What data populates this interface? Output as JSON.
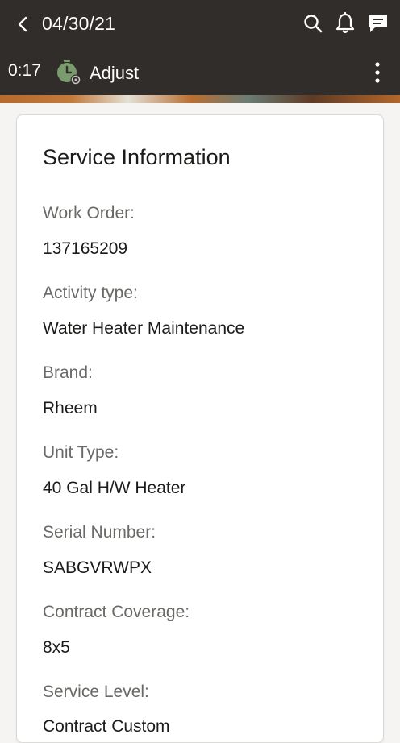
{
  "header": {
    "date": "04/30/21",
    "timer": "0:17",
    "adjust_label": "Adjust",
    "icons": {
      "back": "chevron-left-icon",
      "search": "search-icon",
      "notifications": "bell-icon",
      "messages": "chat-icon",
      "timer": "stopwatch-icon",
      "more": "more-vertical-icon"
    },
    "colors": {
      "bar": "#312d2a",
      "timer_icon": "#7a9b6e"
    }
  },
  "card": {
    "title": "Service Information",
    "fields": [
      {
        "label": "Work Order:",
        "value": "137165209"
      },
      {
        "label": "Activity type:",
        "value": "Water Heater Maintenance"
      },
      {
        "label": "Brand:",
        "value": "Rheem"
      },
      {
        "label": "Unit Type:",
        "value": "40 Gal H/W Heater"
      },
      {
        "label": "Serial Number:",
        "value": "SABGVRWPX"
      },
      {
        "label": "Contract Coverage:",
        "value": "8x5"
      },
      {
        "label": "Service Level:",
        "value": "Contract Custom"
      }
    ]
  }
}
